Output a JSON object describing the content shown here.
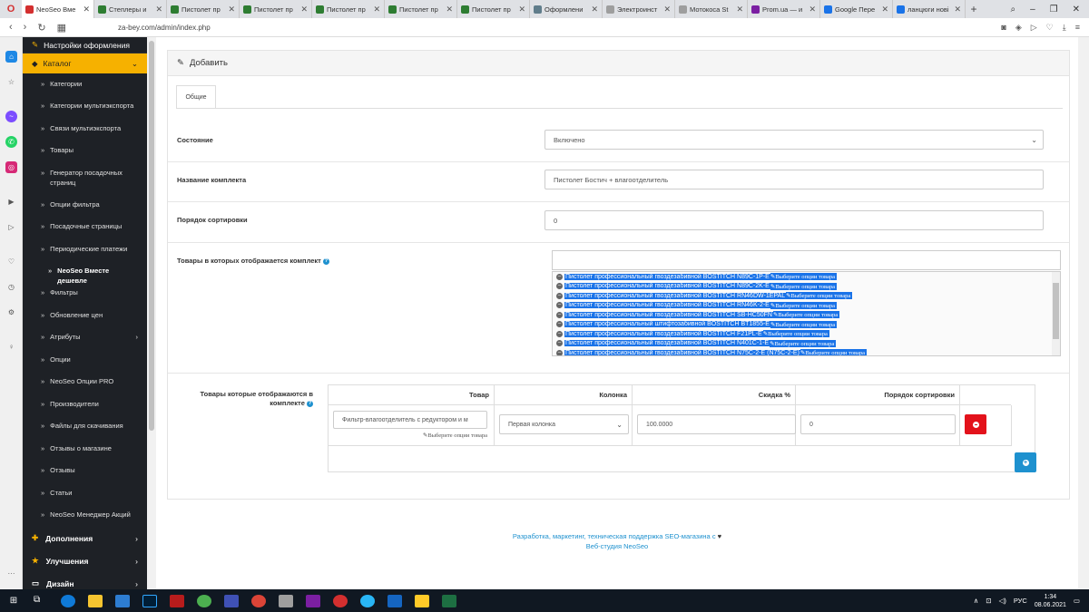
{
  "browser": {
    "tabs": [
      {
        "title": "NeoSeo Вме",
        "active": true
      },
      {
        "title": "Степлеры и"
      },
      {
        "title": "Пистолет пр"
      },
      {
        "title": "Пистолет пр"
      },
      {
        "title": "Пистолет пр"
      },
      {
        "title": "Пистолет пр"
      },
      {
        "title": "Пистолет пр"
      },
      {
        "title": "Оформлени"
      },
      {
        "title": "Электроинст"
      },
      {
        "title": "Мотокоса St"
      },
      {
        "title": "Prom.ua — и"
      },
      {
        "title": "Google Пере"
      },
      {
        "title": "ланцюги нові"
      }
    ],
    "url": "za-bey.com/admin/index.php"
  },
  "sidebar": {
    "top_label": "Настройки оформления",
    "catalog_label": "Каталог",
    "items": [
      {
        "label": "Категории"
      },
      {
        "label": "Категории мультиэкспорта"
      },
      {
        "label": "Связи мультиэкспорта"
      },
      {
        "label": "Товары"
      },
      {
        "label": "Генератор посадочных страниц"
      },
      {
        "label": "Опции фильтра"
      },
      {
        "label": "Посадочные страницы"
      },
      {
        "label": "Периодические платежи"
      },
      {
        "label": "NeoSeo Вместе дешевле",
        "active": true
      },
      {
        "label": "Фильтры"
      },
      {
        "label": "Обновление цен"
      },
      {
        "label": "Атрибуты"
      },
      {
        "label": "Опции"
      },
      {
        "label": "NeoSeo Опции PRO"
      },
      {
        "label": "Производители"
      },
      {
        "label": "Файлы для скачивания"
      },
      {
        "label": "Отзывы о магазине"
      },
      {
        "label": "Отзывы"
      },
      {
        "label": "Статьи"
      },
      {
        "label": "NeoSeo Менеджер Акций"
      }
    ],
    "groups": [
      {
        "label": "Дополнения"
      },
      {
        "label": "Улучшения"
      },
      {
        "label": "Дизайн"
      }
    ]
  },
  "panel": {
    "title": "Добавить",
    "tab_general": "Общие",
    "status_label": "Состояние",
    "status_value": "Включено",
    "name_label": "Название комплекта",
    "name_value": "Пистолет Бостич + влагоотделитель",
    "sort_label": "Порядок сортировки",
    "sort_value": "0",
    "products_label": "Товары в которых отображается комплект",
    "products": [
      {
        "name": "Пистолет профессиональный гвоздезабивной BOSTITCH N89C-1P-E",
        "opt": "Выберите опции товара"
      },
      {
        "name": "Пистолет профессиональный гвоздезабивной BOSTITCH N89C-2K-E",
        "opt": "Выберите опции товара"
      },
      {
        "name": "Пистолет профессиональный гвоздезабивной BOSTITCH RN46DW-1EPAL",
        "opt": "Выберите опции товара"
      },
      {
        "name": "Пистолет профессиональный гвоздезабивной BOSTITCH RN46K-2-E",
        "opt": "Выберите опции товара"
      },
      {
        "name": "Пистолет профессиональный гвоздезабивной BOSTITCH SB-HC50FN",
        "opt": "Выберите опции товара"
      },
      {
        "name": "Пистолет профессиональный штифтозабивной BOSTITCH BT1855-E",
        "opt": "Выберите опции товара"
      },
      {
        "name": "Пистолет профессиональный гвоздезабивной BOSTITCH F21PL-E",
        "opt": "Выберите опции товара"
      },
      {
        "name": "Пистолет профессиональный гвоздезабивной BOSTITCH N401C-1-E",
        "opt": "Выберите опции товара"
      },
      {
        "name": "Пистолет профессиональный гвоздезабивной BOSTITCH N75C-2-E (N75C-2-E)",
        "opt": "Выберите опции товара"
      }
    ],
    "kit_label": "Товары которые отображаются в комплекте",
    "table_headers": {
      "product": "Товар",
      "column": "Колонка",
      "discount": "Скидка %",
      "sort": "Порядок сортировки"
    },
    "row": {
      "product": "Фильтр-влагоотделитель с редуктором и м",
      "product_opt": "Выберите опции товара",
      "column": "Первая колонка",
      "discount": "100.0000",
      "sort": "0"
    }
  },
  "footer": {
    "line1": "Разработка, маркетинг, техническая поддержка SEO-магазина с",
    "line2": "Веб-студия NeoSeo"
  },
  "taskbar": {
    "lang": "РУС",
    "time": "1:34",
    "date": "08.06.2021"
  },
  "colors": {
    "sidebar_bg": "#1e2126",
    "accent": "#f6b100",
    "link": "#1e91cf",
    "danger": "#e3121b",
    "primary": "#1e91cf"
  }
}
